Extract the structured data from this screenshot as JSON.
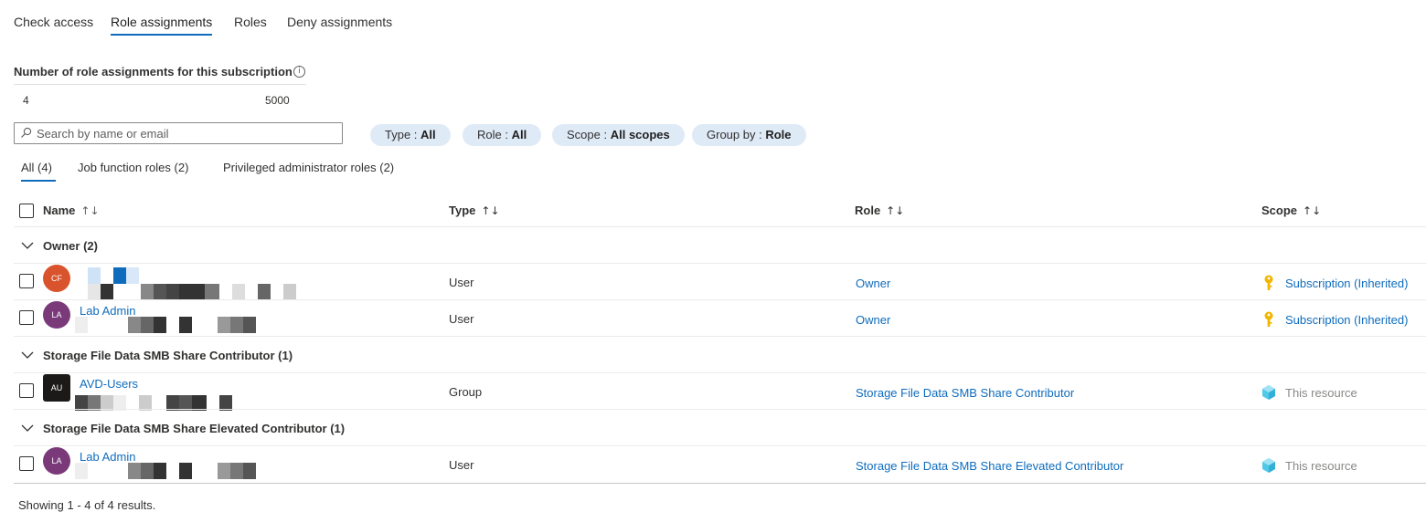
{
  "tabs": [
    {
      "label": "Check access"
    },
    {
      "label": "Role assignments"
    },
    {
      "label": "Roles"
    },
    {
      "label": "Deny assignments"
    }
  ],
  "active_tab": "Role assignments",
  "counter": {
    "title": "Number of role assignments for this subscription",
    "current": "4",
    "max": "5000",
    "info_icon": "info-icon"
  },
  "search": {
    "placeholder": "Search by name or email",
    "value": ""
  },
  "filters": [
    {
      "key": "Type",
      "value": "All"
    },
    {
      "key": "Role",
      "value": "All"
    },
    {
      "key": "Scope",
      "value": "All scopes"
    },
    {
      "key": "Group by",
      "value": "Role"
    }
  ],
  "subtabs": [
    {
      "label": "All (4)"
    },
    {
      "label": "Job function roles (2)"
    },
    {
      "label": "Privileged administrator roles (2)"
    }
  ],
  "columns": {
    "name": "Name",
    "type": "Type",
    "role": "Role",
    "scope": "Scope"
  },
  "groups": [
    {
      "label": "Owner (2)",
      "rows": [
        {
          "initials": "CF",
          "avatar_color": "#d9532c",
          "name": "",
          "type": "User",
          "role": "Owner",
          "scope": "Subscription (Inherited)",
          "scope_icon": "key-icon",
          "scope_inherited": true
        },
        {
          "initials": "LA",
          "avatar_color": "#7a3a7a",
          "name": "Lab Admin",
          "type": "User",
          "role": "Owner",
          "scope": "Subscription (Inherited)",
          "scope_icon": "key-icon",
          "scope_inherited": true
        }
      ]
    },
    {
      "label": "Storage File Data SMB Share Contributor (1)",
      "rows": [
        {
          "initials": "AU",
          "avatar_color": "#1b1a19",
          "name": "AVD-Users",
          "type": "Group",
          "role": "Storage File Data SMB Share Contributor",
          "scope": "This resource",
          "scope_icon": "storage-cube-icon",
          "scope_inherited": false
        }
      ]
    },
    {
      "label": "Storage File Data SMB Share Elevated Contributor (1)",
      "rows": [
        {
          "initials": "LA",
          "avatar_color": "#7a3a7a",
          "name": "Lab Admin",
          "type": "User",
          "role": "Storage File Data SMB Share Elevated Contributor",
          "scope": "This resource",
          "scope_icon": "storage-cube-icon",
          "scope_inherited": false
        }
      ]
    }
  ],
  "footer": "Showing 1 - 4 of 4 results.",
  "colors": {
    "accent": "#0f6cbd",
    "pill_bg": "#dfeaf7",
    "key": "#f2b600",
    "cube": "#50c8e8"
  }
}
